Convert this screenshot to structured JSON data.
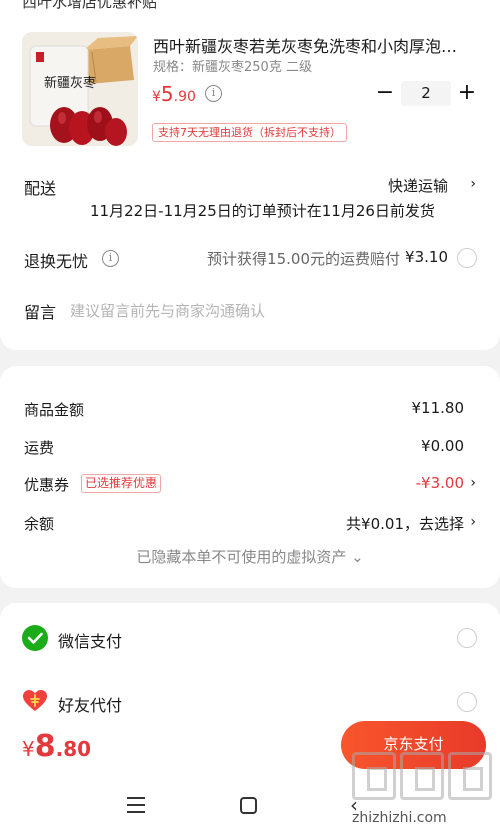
{
  "top_clip": "西叶水增店优惠补贴",
  "product": {
    "image_label": "新疆灰枣",
    "title": "西叶新疆灰枣若羌灰枣免洗枣和小肉厚泡…",
    "spec": "规格：新疆灰枣250克 二级",
    "price_currency": "¥",
    "price_int": "5",
    "price_dec": ".90",
    "quantity": "2",
    "minus_label": "−",
    "plus_label": "+",
    "return_badge": "支持7天无理由退货（拆封后不支持）"
  },
  "shipping": {
    "label": "配送",
    "method": "快递运输",
    "note": "11月22日-11月25日的订单预计在11月26日前发货"
  },
  "return_insurance": {
    "label": "退换无忧",
    "text": "预计获得15.00元的运费赔付",
    "price": "¥3.10"
  },
  "message": {
    "label": "留言",
    "placeholder": "建议留言前先与商家沟通确认"
  },
  "price_summary": {
    "goods_label": "商品金额",
    "goods_value": "¥11.80",
    "shipping_label": "运费",
    "shipping_value": "¥0.00",
    "coupon_label": "优惠券",
    "coupon_tag": "已选推荐优惠",
    "coupon_value": "-¥3.00",
    "balance_label": "余额",
    "balance_value": "共¥0.01，去选择",
    "hidden_assets": "已隐藏本单不可使用的虚拟资产 ⌄"
  },
  "payment": {
    "wechat_label": "微信支付",
    "friend_label": "好友代付",
    "wechat_color": "#1aad19",
    "friend_color": "#f0413f"
  },
  "bottom": {
    "total_currency": "¥",
    "total_int": "8",
    "total_dec": ".80",
    "pay_button": "京东支付"
  },
  "watermark": {
    "text": "zhizhizhi.com"
  }
}
